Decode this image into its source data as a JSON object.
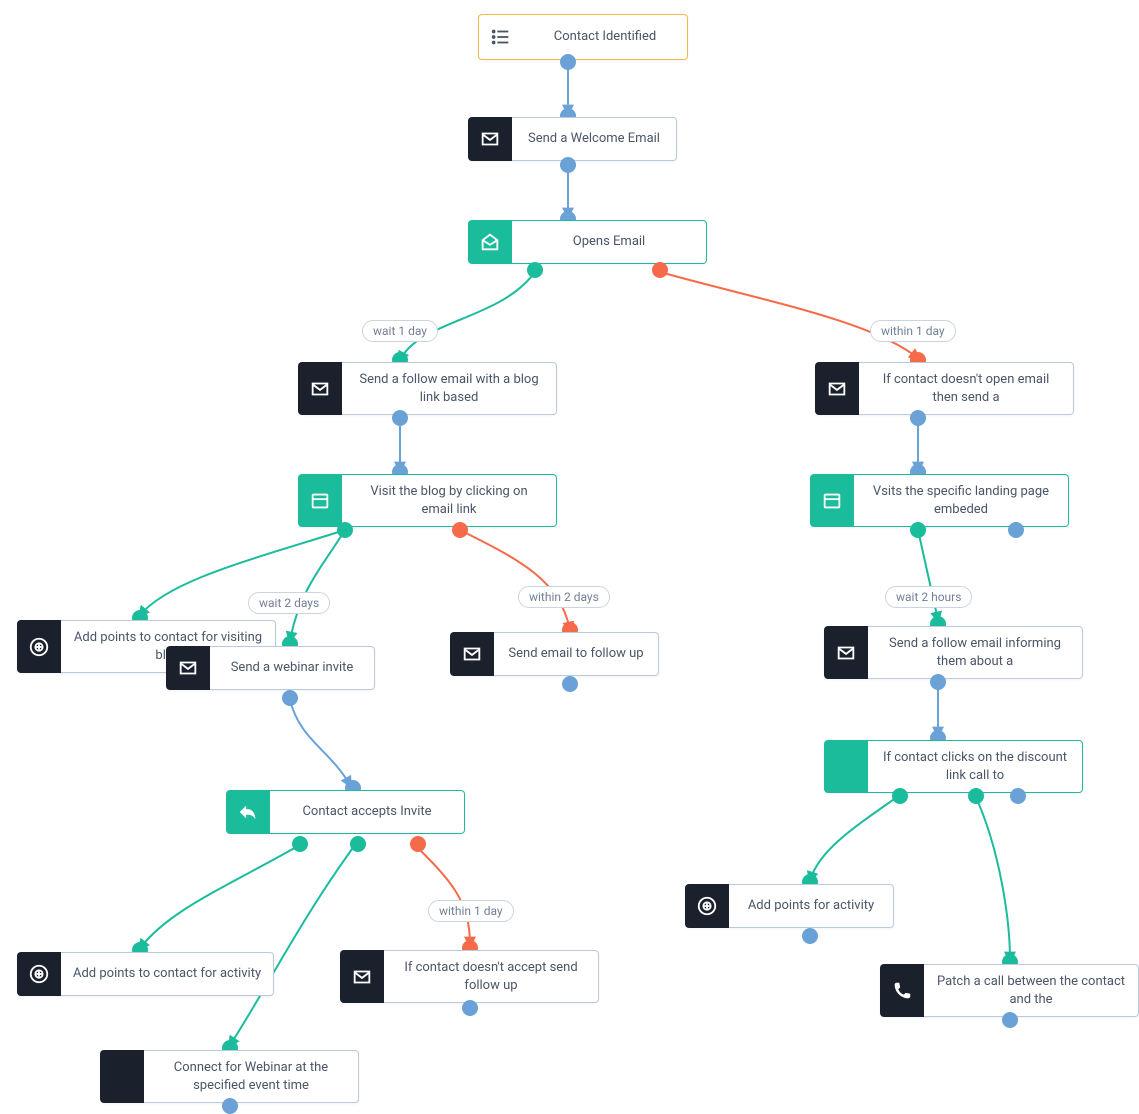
{
  "nodes": {
    "start": {
      "label": "Contact Identified"
    },
    "welcome": {
      "label": "Send a Welcome Email"
    },
    "opens": {
      "label": "Opens Email"
    },
    "follow_blog": {
      "label": "Send a follow email with a blog link based"
    },
    "visit_blog": {
      "label": "Visit the blog by clicking on email link"
    },
    "add_points_blog": {
      "label": "Add points to contact for visiting blog"
    },
    "webinar_invite": {
      "label": "Send a webinar invite"
    },
    "followup_email": {
      "label": "Send email to follow up"
    },
    "accepts_invite": {
      "label": "Contact accepts Invite"
    },
    "add_points_act": {
      "label": "Add points to contact for activity"
    },
    "connect_webinar": {
      "label": "Connect for Webinar at the specified event time"
    },
    "if_not_accept": {
      "label": "If contact doesn't accept send follow up"
    },
    "if_not_open": {
      "label": "If contact doesn't open email then send a"
    },
    "visits_landing": {
      "label": "Vsits the specific landing page embeded"
    },
    "follow_inform": {
      "label": "Send a follow email informing them about a"
    },
    "clicks_discount": {
      "label": "If contact clicks on the discount link call to"
    },
    "add_points_act2": {
      "label": "Add points for activity"
    },
    "patch_call": {
      "label": "Patch a call between the contact and the"
    }
  },
  "chips": {
    "wait1day": "wait 1 day",
    "within1day": "within 1 day",
    "wait2days": "wait 2 days",
    "within2days": "within 2 days",
    "wait2hours": "wait 2 hours",
    "within1day2": "within 1 day"
  },
  "colors": {
    "blue": "#6aa2d8",
    "green": "#1abc9c",
    "red": "#f56b4a",
    "dark": "#1a202c",
    "border_action": "#b9c9df",
    "border_start": "#f2b94a"
  }
}
